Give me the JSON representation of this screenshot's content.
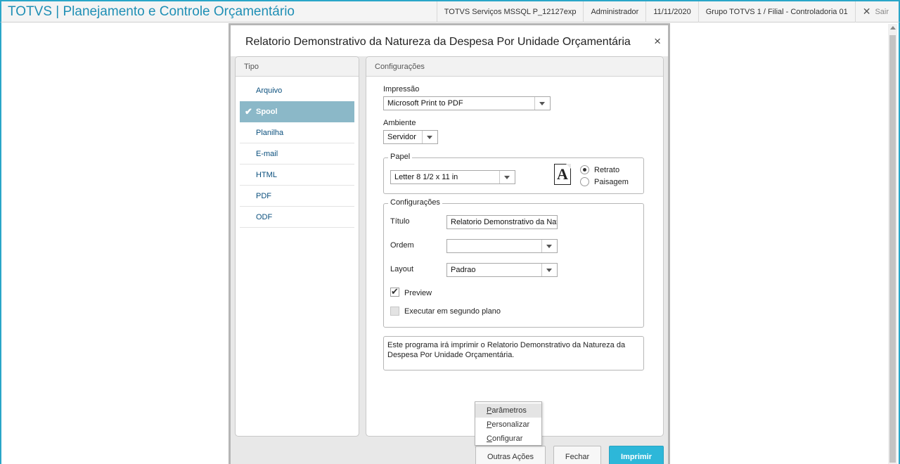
{
  "app": {
    "title": "TOTVS | Planejamento e Controle Orçamentário",
    "environment": "TOTVS Serviços MSSQL P_12127exp",
    "user": "Administrador",
    "date": "11/11/2020",
    "branch": "Grupo TOTVS 1 / Filial - Controladoria 01",
    "exit_label": "Sair"
  },
  "dialog": {
    "title": "Relatorio Demonstrativo da Natureza da Despesa Por Unidade Orçamentária",
    "close_glyph": "×"
  },
  "tipo": {
    "title": "Tipo",
    "items": [
      {
        "label": "Arquivo",
        "active": false
      },
      {
        "label": "Spool",
        "active": true
      },
      {
        "label": "Planilha",
        "active": false
      },
      {
        "label": "E-mail",
        "active": false
      },
      {
        "label": "HTML",
        "active": false
      },
      {
        "label": "PDF",
        "active": false
      },
      {
        "label": "ODF",
        "active": false
      }
    ]
  },
  "config": {
    "title": "Configurações",
    "impressao": {
      "label": "Impressão",
      "value": "Microsoft Print to PDF"
    },
    "ambiente": {
      "label": "Ambiente",
      "value": "Servidor"
    },
    "papel": {
      "legend": "Papel",
      "size": "Letter 8 1/2 x 11 in",
      "icon_letter": "A",
      "orientation_options": [
        "Retrato",
        "Paisagem"
      ],
      "orientation_selected": "Retrato"
    },
    "configuracoes": {
      "legend": "Configurações",
      "titulo": {
        "label": "Título",
        "value": "Relatorio Demonstrativo da Natı"
      },
      "ordem": {
        "label": "Ordem",
        "value": ""
      },
      "layout": {
        "label": "Layout",
        "value": "Padrao"
      },
      "preview": {
        "label": "Preview",
        "checked": true
      },
      "background": {
        "label": "Executar em segundo plano",
        "checked": false
      }
    },
    "description": "Este programa irá imprimir o Relatorio Demonstrativo da Natureza da Despesa Por Unidade Orçamentária."
  },
  "footer": {
    "other_actions": "Outras Ações",
    "close": "Fechar",
    "print": "Imprimir",
    "menu": {
      "parametros": {
        "first": "P",
        "rest": "arâmetros"
      },
      "personalizar": {
        "first": "P",
        "rest": "ersonalizar"
      },
      "configurar": {
        "first": "C",
        "rest": "onfigurar"
      }
    }
  },
  "colors": {
    "accent": "#2aa6c8",
    "primary_button": "#2db7d9",
    "active_item": "#8bb8c8"
  }
}
